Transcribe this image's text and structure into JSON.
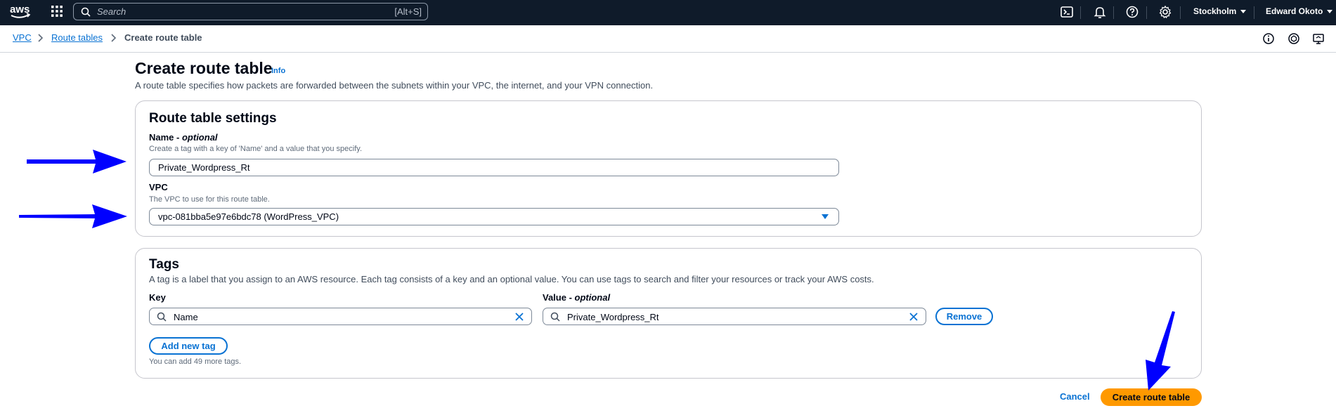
{
  "topnav": {
    "search_placeholder": "Search",
    "search_shortcut": "[Alt+S]",
    "region": "Stockholm",
    "user": "Edward Okoto",
    "icons": [
      "aws-logo",
      "apps-grid-icon",
      "search-icon",
      "cloudshell-icon",
      "bell-icon",
      "help-icon",
      "gear-icon"
    ]
  },
  "breadcrumb": {
    "items": [
      "VPC",
      "Route tables"
    ],
    "current": "Create route table"
  },
  "page": {
    "title": "Create route table",
    "info": "Info",
    "description": "A route table specifies how packets are forwarded between the subnets within your VPC, the internet, and your VPN connection."
  },
  "settings": {
    "title": "Route table settings",
    "name_label": "Name",
    "name_optional": "optional",
    "name_desc": "Create a tag with a key of 'Name' and a value that you specify.",
    "name_value": "Private_Wordpress_Rt",
    "vpc_label": "VPC",
    "vpc_desc": "The VPC to use for this route table.",
    "vpc_value": "vpc-081bba5e97e6bdc78 (WordPress_VPC)"
  },
  "tags": {
    "title": "Tags",
    "description": "A tag is a label that you assign to an AWS resource. Each tag consists of a key and an optional value. You can use tags to search and filter your resources or track your AWS costs.",
    "key_label": "Key",
    "value_label": "Value",
    "value_optional": "optional",
    "rows": [
      {
        "key": "Name",
        "value": "Private_Wordpress_Rt",
        "remove": "Remove"
      }
    ],
    "add_button": "Add new tag",
    "limit_note": "You can add 49 more tags."
  },
  "footer": {
    "cancel": "Cancel",
    "submit": "Create route table"
  },
  "colors": {
    "nav_bg": "#0f1b2a",
    "link": "#0972d3",
    "primary": "#ff9900",
    "annotation_arrow": "#0000ff"
  }
}
